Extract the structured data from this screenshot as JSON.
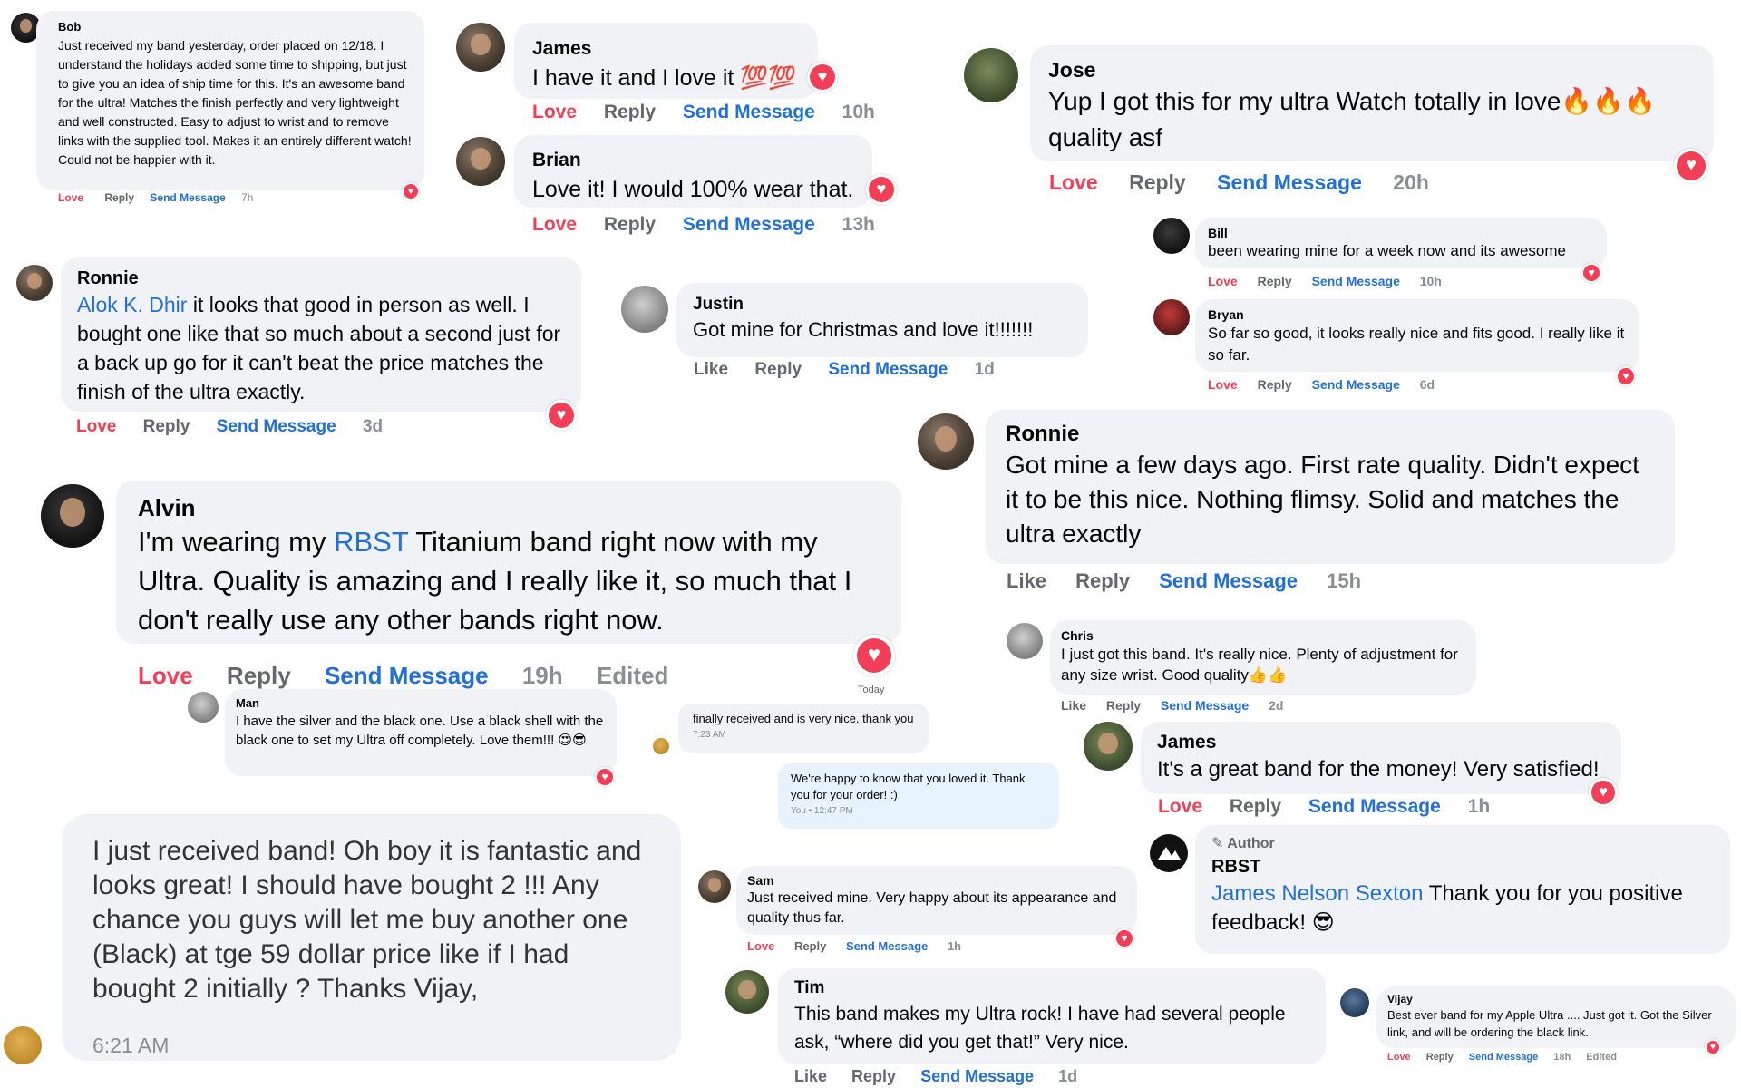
{
  "comments": {
    "bob": {
      "name": "Bob",
      "text": "Just received my band yesterday, order placed on 12/18. I understand the holidays added some time to shipping, but just to give you an idea of ship time for this. It's an awesome band for the ultra! Matches the finish perfectly and very lightweight and well constructed. Easy to adjust to wrist and to remove links with the supplied tool. Makes it an entirely different watch! Could not be happier with it.",
      "love": "Love",
      "reply": "Reply",
      "send": "Send Message",
      "time": "7h"
    },
    "james1": {
      "name": "James",
      "text": "I have it and I love it 💯💯",
      "love": "Love",
      "reply": "Reply",
      "send": "Send Message",
      "time": "10h"
    },
    "brian": {
      "name": "Brian",
      "text": "Love it! I would 100% wear that.",
      "love": "Love",
      "reply": "Reply",
      "send": "Send Message",
      "time": "13h"
    },
    "jose": {
      "name": "Jose",
      "text": "Yup I got this for my ultra Watch totally in love🔥🔥🔥 quality asf",
      "love": "Love",
      "reply": "Reply",
      "send": "Send Message",
      "time": "20h"
    },
    "bill": {
      "name": "Bill",
      "text": "been wearing mine for a week now and its awesome",
      "love": "Love",
      "reply": "Reply",
      "send": "Send Message",
      "time": "10h"
    },
    "bryan": {
      "name": "Bryan",
      "text": "So far so good, it looks really nice and fits good. I really like it so far.",
      "love": "Love",
      "reply": "Reply",
      "send": "Send Message",
      "time": "6d"
    },
    "ronnie1": {
      "name": "Ronnie",
      "mention": "Alok K. Dhir",
      "text": " it looks that good in person as well. I bought one like that so much about a second just for a back up go for it can't beat the price matches the finish of the ultra exactly.",
      "love": "Love",
      "reply": "Reply",
      "send": "Send Message",
      "time": "3d"
    },
    "justin": {
      "name": "Justin",
      "text": "Got mine for Christmas and love it!!!!!!!",
      "like": "Like",
      "reply": "Reply",
      "send": "Send Message",
      "time": "1d"
    },
    "ronnie2": {
      "name": "Ronnie",
      "text": "Got mine a few days ago. First rate quality. Didn't expect it to be this nice. Nothing flimsy. Solid and matches the ultra exactly",
      "like": "Like",
      "reply": "Reply",
      "send": "Send Message",
      "time": "15h"
    },
    "alvin": {
      "name": "Alvin",
      "text_before": "I'm wearing my ",
      "mention": "RBST",
      "text_after": " Titanium band right now with my Ultra. Quality is amazing and I really like it, so much that I don't really use any other bands right now.",
      "love": "Love",
      "reply": "Reply",
      "send": "Send Message",
      "time": "19h",
      "edited": "Edited"
    },
    "man": {
      "name": "Man",
      "text": "I have the silver and the black one. Use a black shell with the black one to set my Ultra off completely. Love them!!! 😍😎"
    },
    "chris": {
      "name": "Chris",
      "text": "I just got this band. It's really nice. Plenty of adjustment for any size wrist. Good quality👍👍",
      "like": "Like",
      "reply": "Reply",
      "send": "Send Message",
      "time": "2d"
    },
    "james2": {
      "name": "James",
      "text": "It's a great band for the money! Very satisfied!",
      "love": "Love",
      "reply": "Reply",
      "send": "Send Message",
      "time": "1h"
    },
    "author": {
      "badge": "Author",
      "name": "RBST",
      "mention": "James Nelson Sexton",
      "text": " Thank you for you positive feedback! 😎"
    },
    "sam": {
      "name": "Sam",
      "text": "Just received mine. Very happy about its appearance and quality thus far.",
      "love": "Love",
      "reply": "Reply",
      "send": "Send Message",
      "time": "1h"
    },
    "tim": {
      "name": "Tim",
      "text": "This band makes my Ultra rock! I have had several people ask, “where did you get that!” Very nice.",
      "like": "Like",
      "reply": "Reply",
      "send": "Send Message",
      "time": "1d"
    },
    "vijay": {
      "name": "Vijay",
      "text": "Best ever band for my Apple Ultra .... Just got it. Got the Silver link, and will be ordering the black link.",
      "love": "Love",
      "reply": "Reply",
      "send": "Send Message",
      "time": "18h",
      "edited": "Edited"
    }
  },
  "chat": {
    "today": "Today",
    "msg1": "finally received and is very nice. thank you",
    "msg1_time": "7:23 AM",
    "msg2": "We're happy to know that you loved it. Thank you for your order! :)",
    "msg2_time": "You • 12:47 PM",
    "msg3": "I just received band! Oh boy it is fantastic and looks great! I should have bought 2 !!! Any chance you guys will let me buy another one (Black) at tge 59 dollar price like if I had bought 2 initially  ? Thanks Vijay,",
    "msg3_time": "6:21 AM"
  },
  "colors": {
    "bubble": "#f0f2f5",
    "love": "#f33e58",
    "link": "#216fdb",
    "muted": "#65676b"
  }
}
